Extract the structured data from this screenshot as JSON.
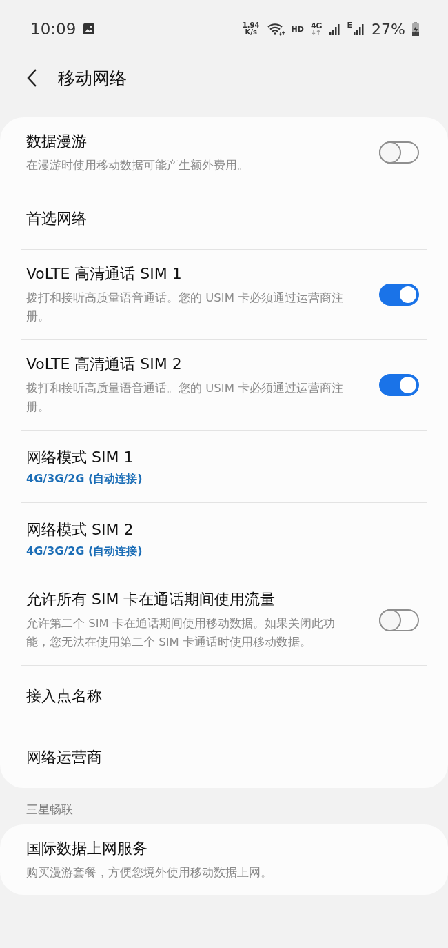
{
  "status_bar": {
    "time": "10:09",
    "speed_value": "1.94",
    "speed_unit": "K/s",
    "hd": "HD",
    "network_4g": "4G",
    "network_e": "E",
    "battery": "27%"
  },
  "header": {
    "title": "移动网络"
  },
  "main_card": {
    "items": [
      {
        "kind": "toggle",
        "title": "数据漫游",
        "subtitle": "在漫游时使用移动数据可能产生额外费用。",
        "on": false
      },
      {
        "kind": "link",
        "title": "首选网络"
      },
      {
        "kind": "toggle",
        "title": "VoLTE 高清通话 SIM 1",
        "subtitle": "拨打和接听高质量语音通话。您的 USIM 卡必须通过运营商注册。",
        "on": true
      },
      {
        "kind": "toggle",
        "title": "VoLTE 高清通话 SIM 2",
        "subtitle": "拨打和接听高质量语音通话。您的 USIM 卡必须通过运营商注册。",
        "on": true
      },
      {
        "kind": "value",
        "title": "网络模式 SIM 1",
        "value": "4G/3G/2G (自动连接)"
      },
      {
        "kind": "value",
        "title": "网络模式 SIM 2",
        "value": "4G/3G/2G (自动连接)"
      },
      {
        "kind": "toggle",
        "title": "允许所有 SIM 卡在通话期间使用流量",
        "subtitle": "允许第二个 SIM 卡在通话期间使用移动数据。如果关闭此功能，您无法在使用第二个 SIM 卡通话时使用移动数据。",
        "on": false
      },
      {
        "kind": "link",
        "title": "接入点名称"
      },
      {
        "kind": "link",
        "title": "网络运营商"
      }
    ]
  },
  "section": {
    "label": "三星畅联",
    "items": [
      {
        "kind": "link",
        "title": "国际数据上网服务",
        "subtitle": "购买漫游套餐，方便您境外使用移动数据上网。"
      }
    ]
  }
}
